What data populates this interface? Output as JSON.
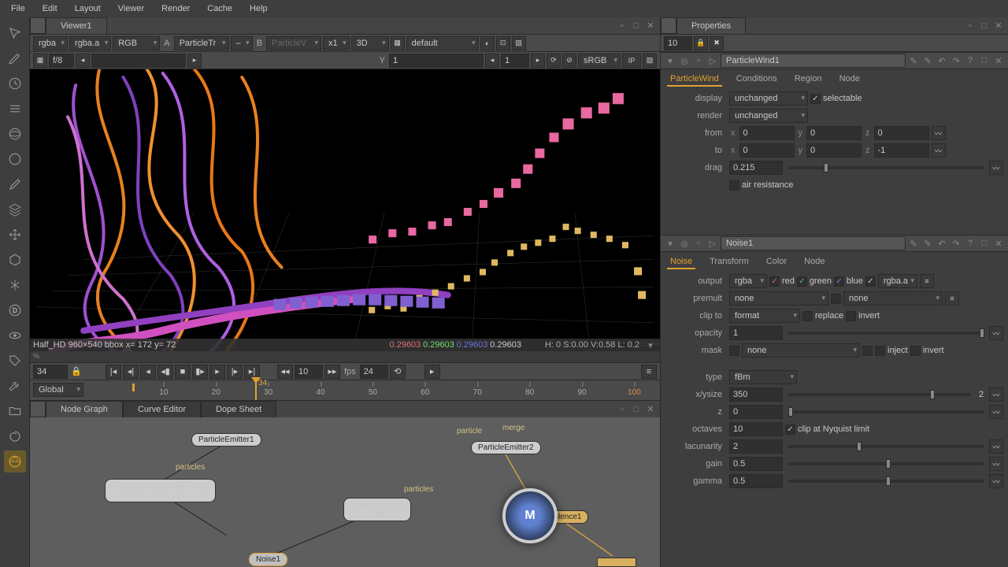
{
  "menu": {
    "file": "File",
    "edit": "Edit",
    "layout": "Layout",
    "viewer": "Viewer",
    "render": "Render",
    "cache": "Cache",
    "help": "Help"
  },
  "viewer": {
    "tab": "Viewer1",
    "channels": "rgba",
    "alpha": "rgba.a",
    "colorspace": "RGB",
    "inputA": "A",
    "inputA_node": "ParticleTr",
    "inputB_empty": "–",
    "inputB": "B",
    "inputB_node": "ParticleV",
    "zoom": "x1",
    "dim": "3D",
    "def": "default",
    "pause_sym": "▦",
    "fs": "f/8",
    "x": "",
    "y": "1",
    "frame_in": "1",
    "srgb": "sRGB",
    "ip": "IP"
  },
  "status": {
    "info": "Half_HD 960×540 bbox  x= 172 y=  72",
    "r": "0.29603",
    "g": "0.29603",
    "b": "0.29603",
    "a": "0.29603",
    "meta": "H:  0 S:0.00 V:0.58   L: 0.2"
  },
  "timeline": {
    "frame": "34",
    "inc": "10",
    "fps_lbl": "fps",
    "fps": "24",
    "end": "100"
  },
  "ruler": {
    "mode": "Global",
    "cur": "34",
    "ticks": [
      "10",
      "20",
      "30",
      "40",
      "50",
      "60",
      "70",
      "80",
      "90",
      "100"
    ]
  },
  "ng": {
    "tabs": {
      "ng": "Node Graph",
      "ce": "Curve Editor",
      "ds": "Dope Sheet"
    },
    "n1": "ParticleEmitter1",
    "n1in": "particles",
    "n2": "ParticleDirectionalForce1",
    "n2b": "(all)",
    "n2in": "particles",
    "n3": "ParticleWind1",
    "n3b": "(all)",
    "n4": "Noise1",
    "n5": "particle",
    "n5b": "merge",
    "n6": "ParticleEmitter2",
    "n7": "urbulence1"
  },
  "props": {
    "title": "Properties",
    "count": "10",
    "panel1": {
      "name": "ParticleWind1",
      "tabs": {
        "a": "ParticleWind",
        "b": "Conditions",
        "c": "Region",
        "d": "Node"
      },
      "display_lbl": "display",
      "display": "unchanged",
      "selectable": "selectable",
      "render_lbl": "render",
      "render": "unchanged",
      "from_lbl": "from",
      "to_lbl": "to",
      "x": "x",
      "y": "y",
      "z": "z",
      "from_x": "0",
      "from_y": "0",
      "from_z": "0",
      "to_x": "0",
      "to_y": "0",
      "to_z": "-1",
      "drag_lbl": "drag",
      "drag": "0.215",
      "air": "air resistance"
    },
    "panel2": {
      "name": "Noise1",
      "tabs": {
        "a": "Noise",
        "b": "Transform",
        "c": "Color",
        "d": "Node"
      },
      "output_lbl": "output",
      "output": "rgba",
      "red": "red",
      "green": "green",
      "blue": "blue",
      "alpha_dd": "rgba.a",
      "premult_lbl": "premult",
      "premult": "none",
      "premult2": "none",
      "clip_lbl": "clip to",
      "clip": "format",
      "replace": "replace",
      "invert": "invert",
      "opacity_lbl": "opacity",
      "opacity": "1",
      "mask_lbl": "mask",
      "mask": "none",
      "inject": "inject",
      "invert2": "invert",
      "type_lbl": "type",
      "type": "fBm",
      "xysize_lbl": "x/ysize",
      "xysize": "350",
      "xysize2": "2",
      "z_lbl": "z",
      "z": "0",
      "oct_lbl": "octaves",
      "oct": "10",
      "clipnyq": "clip at Nyquist limit",
      "lac_lbl": "lacunarity",
      "lac": "2",
      "gain_lbl": "gain",
      "gain": "0.5",
      "gamma_lbl": "gamma",
      "gamma": "0.5"
    }
  }
}
